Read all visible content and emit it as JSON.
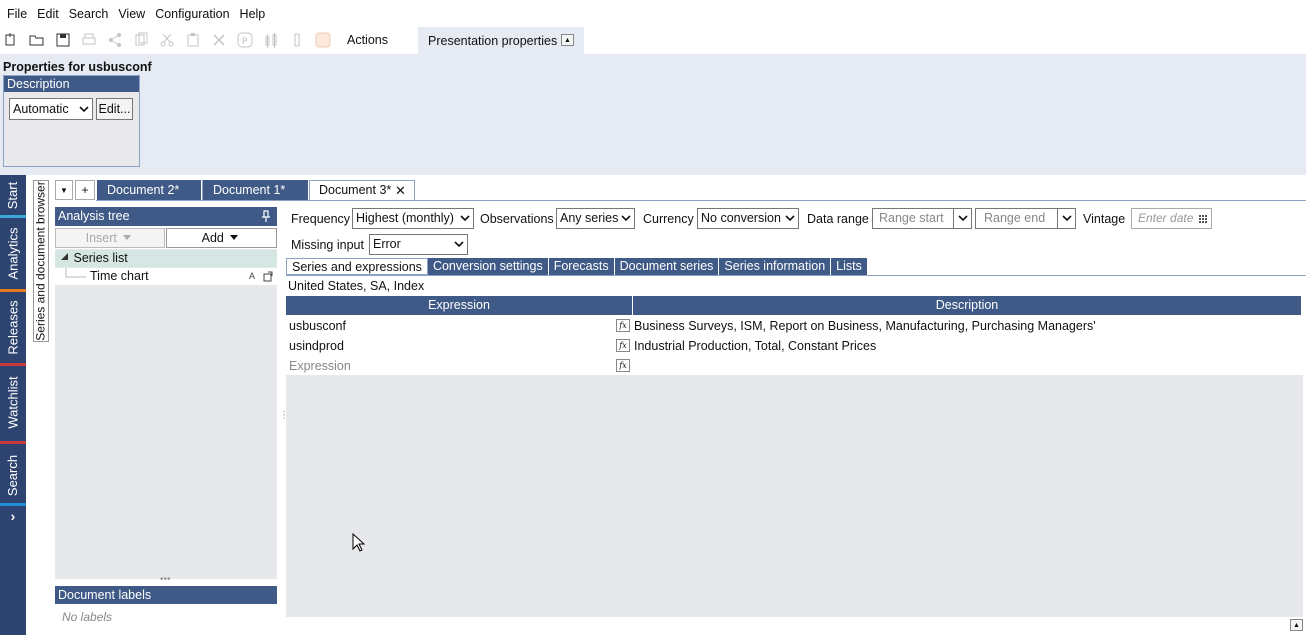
{
  "menu": [
    "File",
    "Edit",
    "Search",
    "View",
    "Configuration",
    "Help"
  ],
  "toolbar": {
    "actions_label": "Actions",
    "presentation_tab": "Presentation properties",
    "collapse_glyph": "▲"
  },
  "properties": {
    "title": "Properties for usbusconf",
    "description_header": "Description",
    "description_mode": "Automatic",
    "edit_label": "Edit..."
  },
  "leftnav": [
    "Start",
    "Analytics",
    "Releases",
    "Watchlist",
    "Search"
  ],
  "leftnav_colors": {
    "Start": "#3aa7d8",
    "Analytics": "#e87722",
    "Releases": "#c8383e",
    "Watchlist": "#c8383e",
    "Search": "#1f8fd8"
  },
  "leftnav_more": "›",
  "browser_strip": "Series and document browser",
  "doc_tabs": {
    "menu": "▼",
    "add": "+",
    "tab1": "Document 2*",
    "tab2": "Document 1*",
    "tab3": "Document 3*",
    "close": "✕"
  },
  "tree": {
    "header": "Analysis tree",
    "insert_label": "Insert",
    "add_label": "Add",
    "series_list": "Series list",
    "time_chart": "Time chart",
    "chart_tag": "A",
    "labels_header": "Document labels",
    "no_labels": "No labels"
  },
  "filters": {
    "frequency_label": "Frequency",
    "frequency_value": "Highest (monthly)",
    "observations_label": "Observations",
    "observations_value": "Any series",
    "currency_label": "Currency",
    "currency_value": "No conversion",
    "range_label": "Data range",
    "range_start": "Range start",
    "range_end": "Range end",
    "vintage_label": "Vintage",
    "vintage_placeholder": "Enter date",
    "missing_label": "Missing input",
    "missing_value": "Error"
  },
  "subtabs": [
    "Series and expressions",
    "Conversion settings",
    "Forecasts",
    "Document series",
    "Series information",
    "Lists"
  ],
  "series_info": "United States, SA, Index",
  "grid": {
    "col_expression": "Expression",
    "col_description": "Description",
    "fx_label": "fx",
    "rows": [
      {
        "expression": "usbusconf",
        "description": "Business Surveys, ISM, Report on Business, Manufacturing, Purchasing Managers'"
      },
      {
        "expression": "usindprod",
        "description": "Industrial Production, Total, Constant Prices"
      }
    ],
    "placeholder": "Expression"
  }
}
